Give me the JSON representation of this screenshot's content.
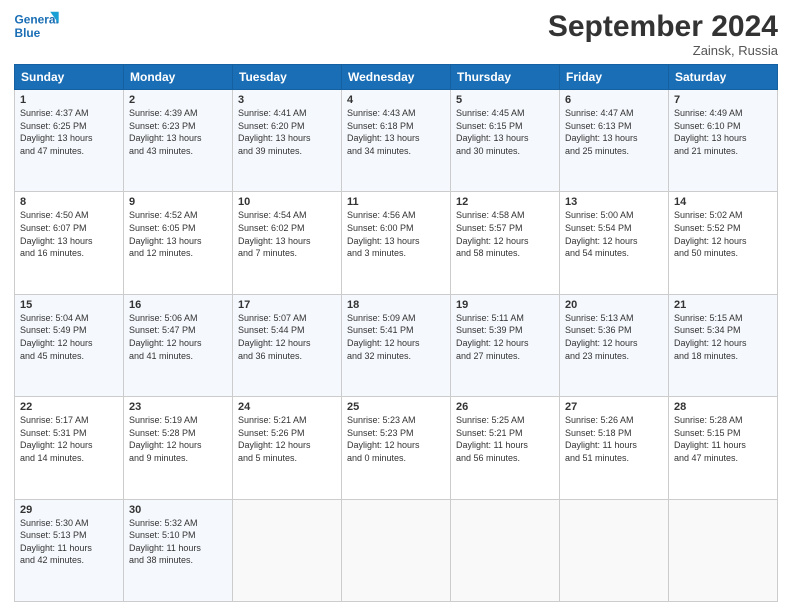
{
  "logo": {
    "line1": "General",
    "line2": "Blue"
  },
  "header": {
    "month": "September 2024",
    "location": "Zainsk, Russia"
  },
  "weekdays": [
    "Sunday",
    "Monday",
    "Tuesday",
    "Wednesday",
    "Thursday",
    "Friday",
    "Saturday"
  ],
  "weeks": [
    [
      {
        "day": "1",
        "text": "Sunrise: 4:37 AM\nSunset: 6:25 PM\nDaylight: 13 hours\nand 47 minutes."
      },
      {
        "day": "2",
        "text": "Sunrise: 4:39 AM\nSunset: 6:23 PM\nDaylight: 13 hours\nand 43 minutes."
      },
      {
        "day": "3",
        "text": "Sunrise: 4:41 AM\nSunset: 6:20 PM\nDaylight: 13 hours\nand 39 minutes."
      },
      {
        "day": "4",
        "text": "Sunrise: 4:43 AM\nSunset: 6:18 PM\nDaylight: 13 hours\nand 34 minutes."
      },
      {
        "day": "5",
        "text": "Sunrise: 4:45 AM\nSunset: 6:15 PM\nDaylight: 13 hours\nand 30 minutes."
      },
      {
        "day": "6",
        "text": "Sunrise: 4:47 AM\nSunset: 6:13 PM\nDaylight: 13 hours\nand 25 minutes."
      },
      {
        "day": "7",
        "text": "Sunrise: 4:49 AM\nSunset: 6:10 PM\nDaylight: 13 hours\nand 21 minutes."
      }
    ],
    [
      {
        "day": "8",
        "text": "Sunrise: 4:50 AM\nSunset: 6:07 PM\nDaylight: 13 hours\nand 16 minutes."
      },
      {
        "day": "9",
        "text": "Sunrise: 4:52 AM\nSunset: 6:05 PM\nDaylight: 13 hours\nand 12 minutes."
      },
      {
        "day": "10",
        "text": "Sunrise: 4:54 AM\nSunset: 6:02 PM\nDaylight: 13 hours\nand 7 minutes."
      },
      {
        "day": "11",
        "text": "Sunrise: 4:56 AM\nSunset: 6:00 PM\nDaylight: 13 hours\nand 3 minutes."
      },
      {
        "day": "12",
        "text": "Sunrise: 4:58 AM\nSunset: 5:57 PM\nDaylight: 12 hours\nand 58 minutes."
      },
      {
        "day": "13",
        "text": "Sunrise: 5:00 AM\nSunset: 5:54 PM\nDaylight: 12 hours\nand 54 minutes."
      },
      {
        "day": "14",
        "text": "Sunrise: 5:02 AM\nSunset: 5:52 PM\nDaylight: 12 hours\nand 50 minutes."
      }
    ],
    [
      {
        "day": "15",
        "text": "Sunrise: 5:04 AM\nSunset: 5:49 PM\nDaylight: 12 hours\nand 45 minutes."
      },
      {
        "day": "16",
        "text": "Sunrise: 5:06 AM\nSunset: 5:47 PM\nDaylight: 12 hours\nand 41 minutes."
      },
      {
        "day": "17",
        "text": "Sunrise: 5:07 AM\nSunset: 5:44 PM\nDaylight: 12 hours\nand 36 minutes."
      },
      {
        "day": "18",
        "text": "Sunrise: 5:09 AM\nSunset: 5:41 PM\nDaylight: 12 hours\nand 32 minutes."
      },
      {
        "day": "19",
        "text": "Sunrise: 5:11 AM\nSunset: 5:39 PM\nDaylight: 12 hours\nand 27 minutes."
      },
      {
        "day": "20",
        "text": "Sunrise: 5:13 AM\nSunset: 5:36 PM\nDaylight: 12 hours\nand 23 minutes."
      },
      {
        "day": "21",
        "text": "Sunrise: 5:15 AM\nSunset: 5:34 PM\nDaylight: 12 hours\nand 18 minutes."
      }
    ],
    [
      {
        "day": "22",
        "text": "Sunrise: 5:17 AM\nSunset: 5:31 PM\nDaylight: 12 hours\nand 14 minutes."
      },
      {
        "day": "23",
        "text": "Sunrise: 5:19 AM\nSunset: 5:28 PM\nDaylight: 12 hours\nand 9 minutes."
      },
      {
        "day": "24",
        "text": "Sunrise: 5:21 AM\nSunset: 5:26 PM\nDaylight: 12 hours\nand 5 minutes."
      },
      {
        "day": "25",
        "text": "Sunrise: 5:23 AM\nSunset: 5:23 PM\nDaylight: 12 hours\nand 0 minutes."
      },
      {
        "day": "26",
        "text": "Sunrise: 5:25 AM\nSunset: 5:21 PM\nDaylight: 11 hours\nand 56 minutes."
      },
      {
        "day": "27",
        "text": "Sunrise: 5:26 AM\nSunset: 5:18 PM\nDaylight: 11 hours\nand 51 minutes."
      },
      {
        "day": "28",
        "text": "Sunrise: 5:28 AM\nSunset: 5:15 PM\nDaylight: 11 hours\nand 47 minutes."
      }
    ],
    [
      {
        "day": "29",
        "text": "Sunrise: 5:30 AM\nSunset: 5:13 PM\nDaylight: 11 hours\nand 42 minutes."
      },
      {
        "day": "30",
        "text": "Sunrise: 5:32 AM\nSunset: 5:10 PM\nDaylight: 11 hours\nand 38 minutes."
      },
      {
        "day": "",
        "text": ""
      },
      {
        "day": "",
        "text": ""
      },
      {
        "day": "",
        "text": ""
      },
      {
        "day": "",
        "text": ""
      },
      {
        "day": "",
        "text": ""
      }
    ]
  ]
}
